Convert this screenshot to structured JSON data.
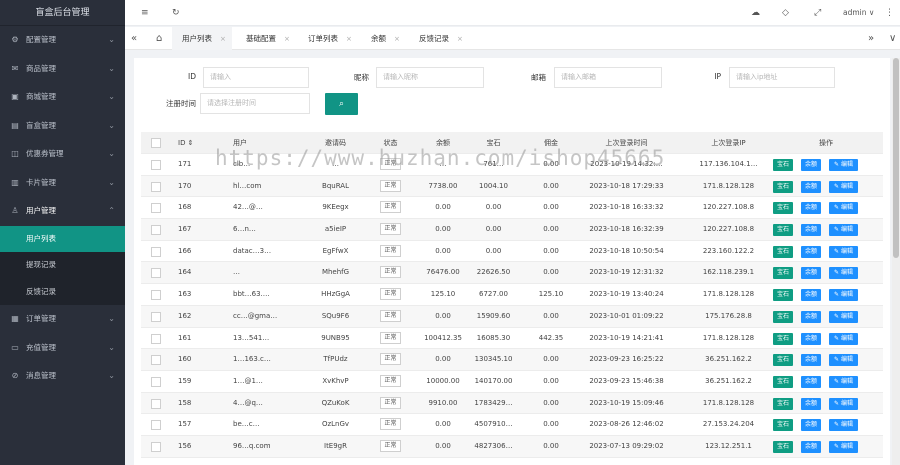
{
  "sidebar": {
    "brand": "盲盒后台管理",
    "items": [
      {
        "label": "配置管理",
        "icon": "gear-icon",
        "glyph": "⚙",
        "arrow": "⌄"
      },
      {
        "label": "商品管理",
        "icon": "mail-icon",
        "glyph": "✉",
        "arrow": "⌄"
      },
      {
        "label": "商城管理",
        "icon": "shop-icon",
        "glyph": "▣",
        "arrow": "⌄"
      },
      {
        "label": "盲盒管理",
        "icon": "gift-icon",
        "glyph": "▤",
        "arrow": "⌄"
      },
      {
        "label": "优惠券管理",
        "icon": "coupon-icon",
        "glyph": "◫",
        "arrow": "⌄"
      },
      {
        "label": "卡片管理",
        "icon": "card-icon",
        "glyph": "▥",
        "arrow": "⌄"
      },
      {
        "label": "用户管理",
        "icon": "user-icon",
        "glyph": "♙",
        "arrow": "⌃"
      },
      {
        "label": "订单管理",
        "icon": "order-icon",
        "glyph": "▦",
        "arrow": "⌄"
      },
      {
        "label": "充值管理",
        "icon": "wallet-icon",
        "glyph": "▭",
        "arrow": "⌄"
      },
      {
        "label": "消息管理",
        "icon": "tag-icon",
        "glyph": "⊘",
        "arrow": "⌄"
      }
    ],
    "sub_items": [
      {
        "label": "用户列表"
      },
      {
        "label": "提现记录"
      },
      {
        "label": "反馈记录"
      }
    ]
  },
  "topbar": {
    "menu_icon": "≡",
    "refresh_icon": "↻",
    "theme_icon": "☁",
    "tag_icon": "◇",
    "fullscreen_icon": "⤢",
    "user": "admin",
    "user_arrow": "∨",
    "more_icon": "⋮"
  },
  "tabs": {
    "prev": "«",
    "next": "»",
    "dropdown": "∨",
    "home": "⌂",
    "items": [
      {
        "label": "用户列表"
      },
      {
        "label": "基础配置"
      },
      {
        "label": "订单列表"
      },
      {
        "label": "余额"
      },
      {
        "label": "反馈记录"
      }
    ],
    "close": "×"
  },
  "filters": {
    "id_label": "ID",
    "id_placeholder": "请输入",
    "nick_label": "昵称",
    "nick_placeholder": "请输入昵称",
    "email_label": "邮箱",
    "email_placeholder": "请输入邮箱",
    "ip_label": "IP",
    "ip_placeholder": "请输入ip地址",
    "reg_label": "注册时间",
    "reg_placeholder": "请选择注册时间",
    "search_icon": "⌕"
  },
  "table": {
    "headers": [
      "ID ⇕",
      "用户",
      "邀请码",
      "状态",
      "余额",
      "宝石",
      "佣金",
      "上次登录时间",
      "上次登录IP",
      "操作"
    ],
    "actions": [
      "宝石",
      "余额",
      "✎ 编辑"
    ],
    "rows": [
      {
        "id": "171",
        "user": "clb…",
        "code": "…",
        "status": "正常",
        "balance": "…",
        "gems": "761…",
        "commission": "0.00",
        "time": "2023-10-19 14:32:…",
        "ip": "117.136.104.1…"
      },
      {
        "id": "170",
        "user": "hl…com",
        "code": "BquRAL",
        "status": "正常",
        "balance": "7738.00",
        "gems": "1004.10",
        "commission": "0.00",
        "time": "2023-10-18 17:29:33",
        "ip": "171.8.128.128"
      },
      {
        "id": "168",
        "user": "42…@…",
        "code": "9KEegx",
        "status": "正常",
        "balance": "0.00",
        "gems": "0.00",
        "commission": "0.00",
        "time": "2023-10-18 16:33:32",
        "ip": "120.227.108.8"
      },
      {
        "id": "167",
        "user": "6…n…",
        "code": "a5ieIP",
        "status": "正常",
        "balance": "0.00",
        "gems": "0.00",
        "commission": "0.00",
        "time": "2023-10-18 16:32:39",
        "ip": "120.227.108.8"
      },
      {
        "id": "166",
        "user": "datac…3…",
        "code": "EgFfwX",
        "status": "正常",
        "balance": "0.00",
        "gems": "0.00",
        "commission": "0.00",
        "time": "2023-10-18 10:50:54",
        "ip": "223.160.122.2"
      },
      {
        "id": "164",
        "user": "…",
        "code": "MhehfG",
        "status": "正常",
        "balance": "76476.00",
        "gems": "22626.50",
        "commission": "0.00",
        "time": "2023-10-19 12:31:32",
        "ip": "162.118.239.1"
      },
      {
        "id": "163",
        "user": "bbt…63.…",
        "code": "HHzGgA",
        "status": "正常",
        "balance": "125.10",
        "gems": "6727.00",
        "commission": "125.10",
        "time": "2023-10-19 13:40:24",
        "ip": "171.8.128.128"
      },
      {
        "id": "162",
        "user": "cc…@gma…",
        "code": "SQu9F6",
        "status": "正常",
        "balance": "0.00",
        "gems": "15909.60",
        "commission": "0.00",
        "time": "2023-10-01 01:09:22",
        "ip": "175.176.28.8"
      },
      {
        "id": "161",
        "user": "13…541…",
        "code": "9UNB95",
        "status": "正常",
        "balance": "100412.35",
        "gems": "16085.30",
        "commission": "442.35",
        "time": "2023-10-19 14:21:41",
        "ip": "171.8.128.128"
      },
      {
        "id": "160",
        "user": "1…163.c…",
        "code": "TfPUdz",
        "status": "正常",
        "balance": "0.00",
        "gems": "130345.10",
        "commission": "0.00",
        "time": "2023-09-23 16:25:22",
        "ip": "36.251.162.2"
      },
      {
        "id": "159",
        "user": "1…@1…",
        "code": "XvKhvP",
        "status": "正常",
        "balance": "10000.00",
        "gems": "140170.00",
        "commission": "0.00",
        "time": "2023-09-23 15:46:38",
        "ip": "36.251.162.2"
      },
      {
        "id": "158",
        "user": "4…@q…",
        "code": "QZuKoK",
        "status": "正常",
        "balance": "9910.00",
        "gems": "1783429…",
        "commission": "0.00",
        "time": "2023-10-19 15:09:46",
        "ip": "171.8.128.128"
      },
      {
        "id": "157",
        "user": "be…c…",
        "code": "OzLnGv",
        "status": "正常",
        "balance": "0.00",
        "gems": "4507910…",
        "commission": "0.00",
        "time": "2023-08-26 12:46:02",
        "ip": "27.153.24.204"
      },
      {
        "id": "156",
        "user": "96…q.com",
        "code": "ItE9gR",
        "status": "正常",
        "balance": "0.00",
        "gems": "4827306…",
        "commission": "0.00",
        "time": "2023-07-13 09:29:02",
        "ip": "123.12.251.1"
      }
    ]
  },
  "watermark": "https://www.huzhan.com/ishop45665"
}
